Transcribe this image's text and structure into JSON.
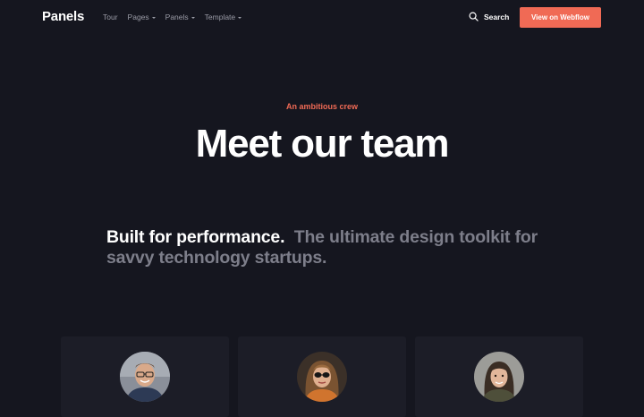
{
  "nav": {
    "logo": "Panels",
    "links": [
      {
        "label": "Tour",
        "has_caret": false
      },
      {
        "label": "Pages",
        "has_caret": true
      },
      {
        "label": "Panels",
        "has_caret": true
      },
      {
        "label": "Template",
        "has_caret": true
      }
    ],
    "search_label": "Search",
    "search_icon": "search-icon",
    "cta_label": "View on Webflow"
  },
  "hero": {
    "eyebrow": "An ambitious crew",
    "title": "Meet our team"
  },
  "lead": {
    "strong": "Built for performance.",
    "muted": "The ultimate design toolkit for savvy technology startups."
  },
  "team": [
    {
      "avatar": "avatar-man-glasses"
    },
    {
      "avatar": "avatar-woman-sunglasses"
    },
    {
      "avatar": "avatar-woman-dark-hair"
    }
  ],
  "colors": {
    "background": "#15161f",
    "card": "#1c1d27",
    "accent": "#f06a55",
    "muted": "#7d7e8a"
  }
}
